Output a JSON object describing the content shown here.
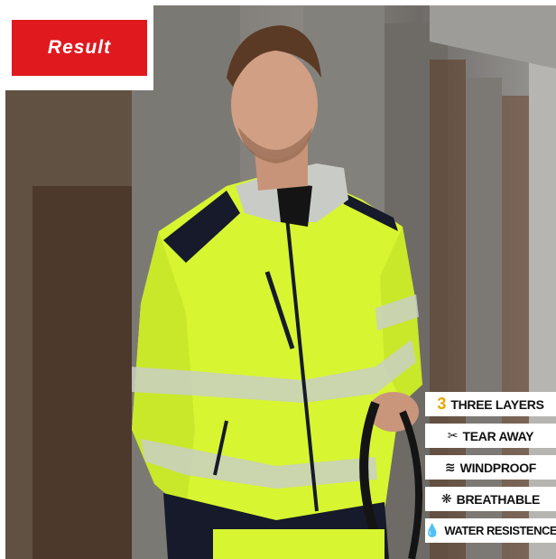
{
  "logo": {
    "text": "Result",
    "color": "#e0191f"
  },
  "features": [
    {
      "icon": "3",
      "icon_name": "number-three-icon",
      "label": "THREE LAYERS"
    },
    {
      "icon": "✂",
      "icon_name": "scissors-icon",
      "label": "TEAR AWAY"
    },
    {
      "icon": "≋",
      "icon_name": "wind-icon",
      "label": "WINDPROOF"
    },
    {
      "icon": "❋",
      "icon_name": "breathable-icon",
      "label": "BREATHABLE"
    },
    {
      "icon": "💧",
      "icon_name": "water-drop-icon",
      "label": "WATER RESISTENCE"
    }
  ],
  "colors": {
    "hi_vis_yellow": "#d7f531",
    "navy": "#161a2a",
    "reflective": "#c9cfc4"
  }
}
